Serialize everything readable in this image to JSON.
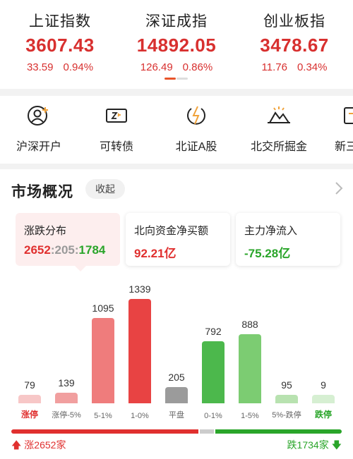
{
  "indices": [
    {
      "name": "上证指数",
      "value": "3607.43",
      "change": "33.59",
      "pct": "0.94%"
    },
    {
      "name": "深证成指",
      "value": "14892.05",
      "change": "126.49",
      "pct": "0.86%"
    },
    {
      "name": "创业板指",
      "value": "3478.67",
      "change": "11.76",
      "pct": "0.34%"
    }
  ],
  "shortcuts": [
    {
      "label": "沪深开户",
      "icon": "user-plus-icon"
    },
    {
      "label": "可转债",
      "icon": "bond-ticket-icon"
    },
    {
      "label": "北证A股",
      "icon": "lightning-coin-icon"
    },
    {
      "label": "北交所掘金",
      "icon": "gold-mine-icon"
    },
    {
      "label": "新三",
      "icon": "new-three-board-icon"
    }
  ],
  "market": {
    "title": "市场概况",
    "collapse_label": "收起",
    "cards": [
      {
        "title": "涨跌分布",
        "up": "2652",
        "flat": "205",
        "down": "1784",
        "sep": ":"
      },
      {
        "title": "北向资金净买额",
        "value": "92.21亿"
      },
      {
        "title": "主力净流入",
        "value": "-75.28亿"
      }
    ],
    "rise_text": "涨2652家",
    "fall_text": "跌1734家",
    "ratio": {
      "up": 2652,
      "flat": 205,
      "down": 1784
    }
  },
  "chart_data": {
    "type": "bar",
    "categories": [
      "涨停",
      "涨停-5%",
      "5-1%",
      "1-0%",
      "平盘",
      "0-1%",
      "1-5%",
      "5%-跌停",
      "跌停"
    ],
    "values": [
      79,
      139,
      1095,
      1339,
      205,
      792,
      888,
      95,
      9
    ],
    "value_labels": [
      "79",
      "139",
      "1095",
      "1339",
      "205",
      "792",
      "888",
      "95",
      "9"
    ],
    "colors": [
      "#f7c7c7",
      "#f19f9f",
      "#ef7c7c",
      "#e84343",
      "#9b9b9b",
      "#4cb84c",
      "#7ccc72",
      "#b8e2b0",
      "#d6efd2"
    ],
    "ylim": [
      0,
      1339
    ]
  },
  "colors": {
    "rise": "#e0302f",
    "fall": "#2aa52a",
    "flat": "#999999"
  }
}
